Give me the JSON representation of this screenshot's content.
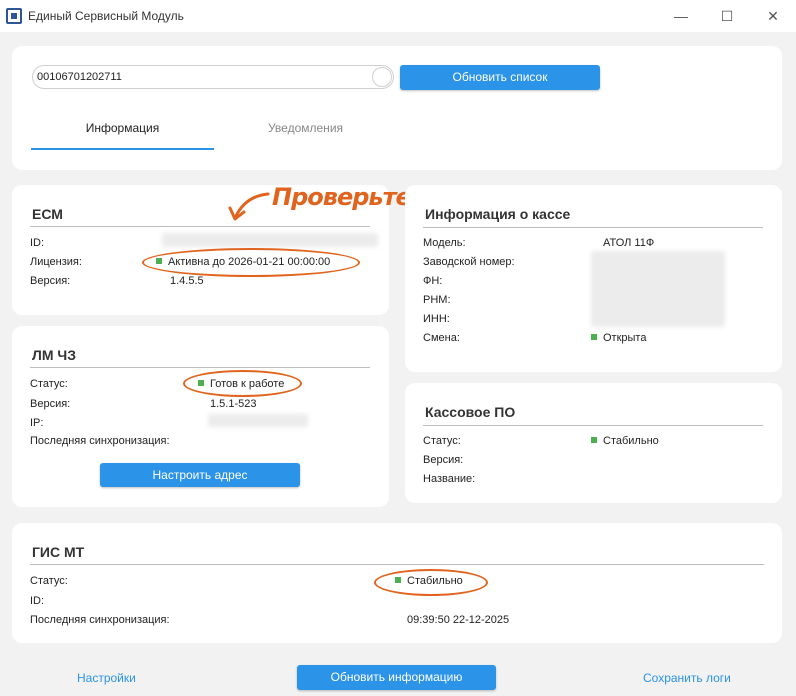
{
  "window": {
    "title": "Единый Сервисный Модуль"
  },
  "top": {
    "search_value": "00106701202711",
    "refresh_list_label": "Обновить список",
    "tabs": [
      {
        "label": "Информация"
      },
      {
        "label": "Уведомления"
      }
    ]
  },
  "ecm": {
    "title": "ЕСМ",
    "id_label": "ID:",
    "license_label": "Лицензия:",
    "license_value": "Активна до 2026-01-21 00:00:00",
    "version_label": "Версия:",
    "version_value": "1.4.5.5"
  },
  "lmcz": {
    "title": "ЛМ ЧЗ",
    "status_label": "Статус:",
    "status_value": "Готов к работе",
    "version_label": "Версия:",
    "version_value": "1.5.1-523",
    "ip_label": "IP:",
    "sync_label": "Последняя синхронизация:",
    "configure_label": "Настроить адрес"
  },
  "kassa": {
    "title": "Информация о кассе",
    "model_label": "Модель:",
    "model_value": "АТОЛ 11Ф",
    "serial_label": "Заводской номер:",
    "fn_label": "ФН:",
    "rnm_label": "РНМ:",
    "inn_label": "ИНН:",
    "shift_label": "Смена:",
    "shift_value": "Открыта"
  },
  "po": {
    "title": "Кассовое ПО",
    "status_label": "Статус:",
    "status_value": "Стабильно",
    "version_label": "Версия:",
    "name_label": "Название:"
  },
  "gis": {
    "title": "ГИС МТ",
    "status_label": "Статус:",
    "status_value": "Стабильно",
    "id_label": "ID:",
    "sync_label": "Последняя синхронизация:",
    "sync_value": "09:39:50 22-12-2025"
  },
  "footer": {
    "settings_label": "Настройки",
    "refresh_info_label": "Обновить информацию",
    "save_logs_label": "Сохранить логи"
  },
  "annotation": {
    "text": "Проверьте",
    "color": "#e0641e"
  },
  "colors": {
    "accent": "#2b93e8",
    "status_ok": "#4caf50"
  },
  "icons": [
    "app-icon",
    "minimize-icon",
    "maximize-icon",
    "close-icon",
    "status-dot-icon",
    "arrow-annotation-icon"
  ]
}
